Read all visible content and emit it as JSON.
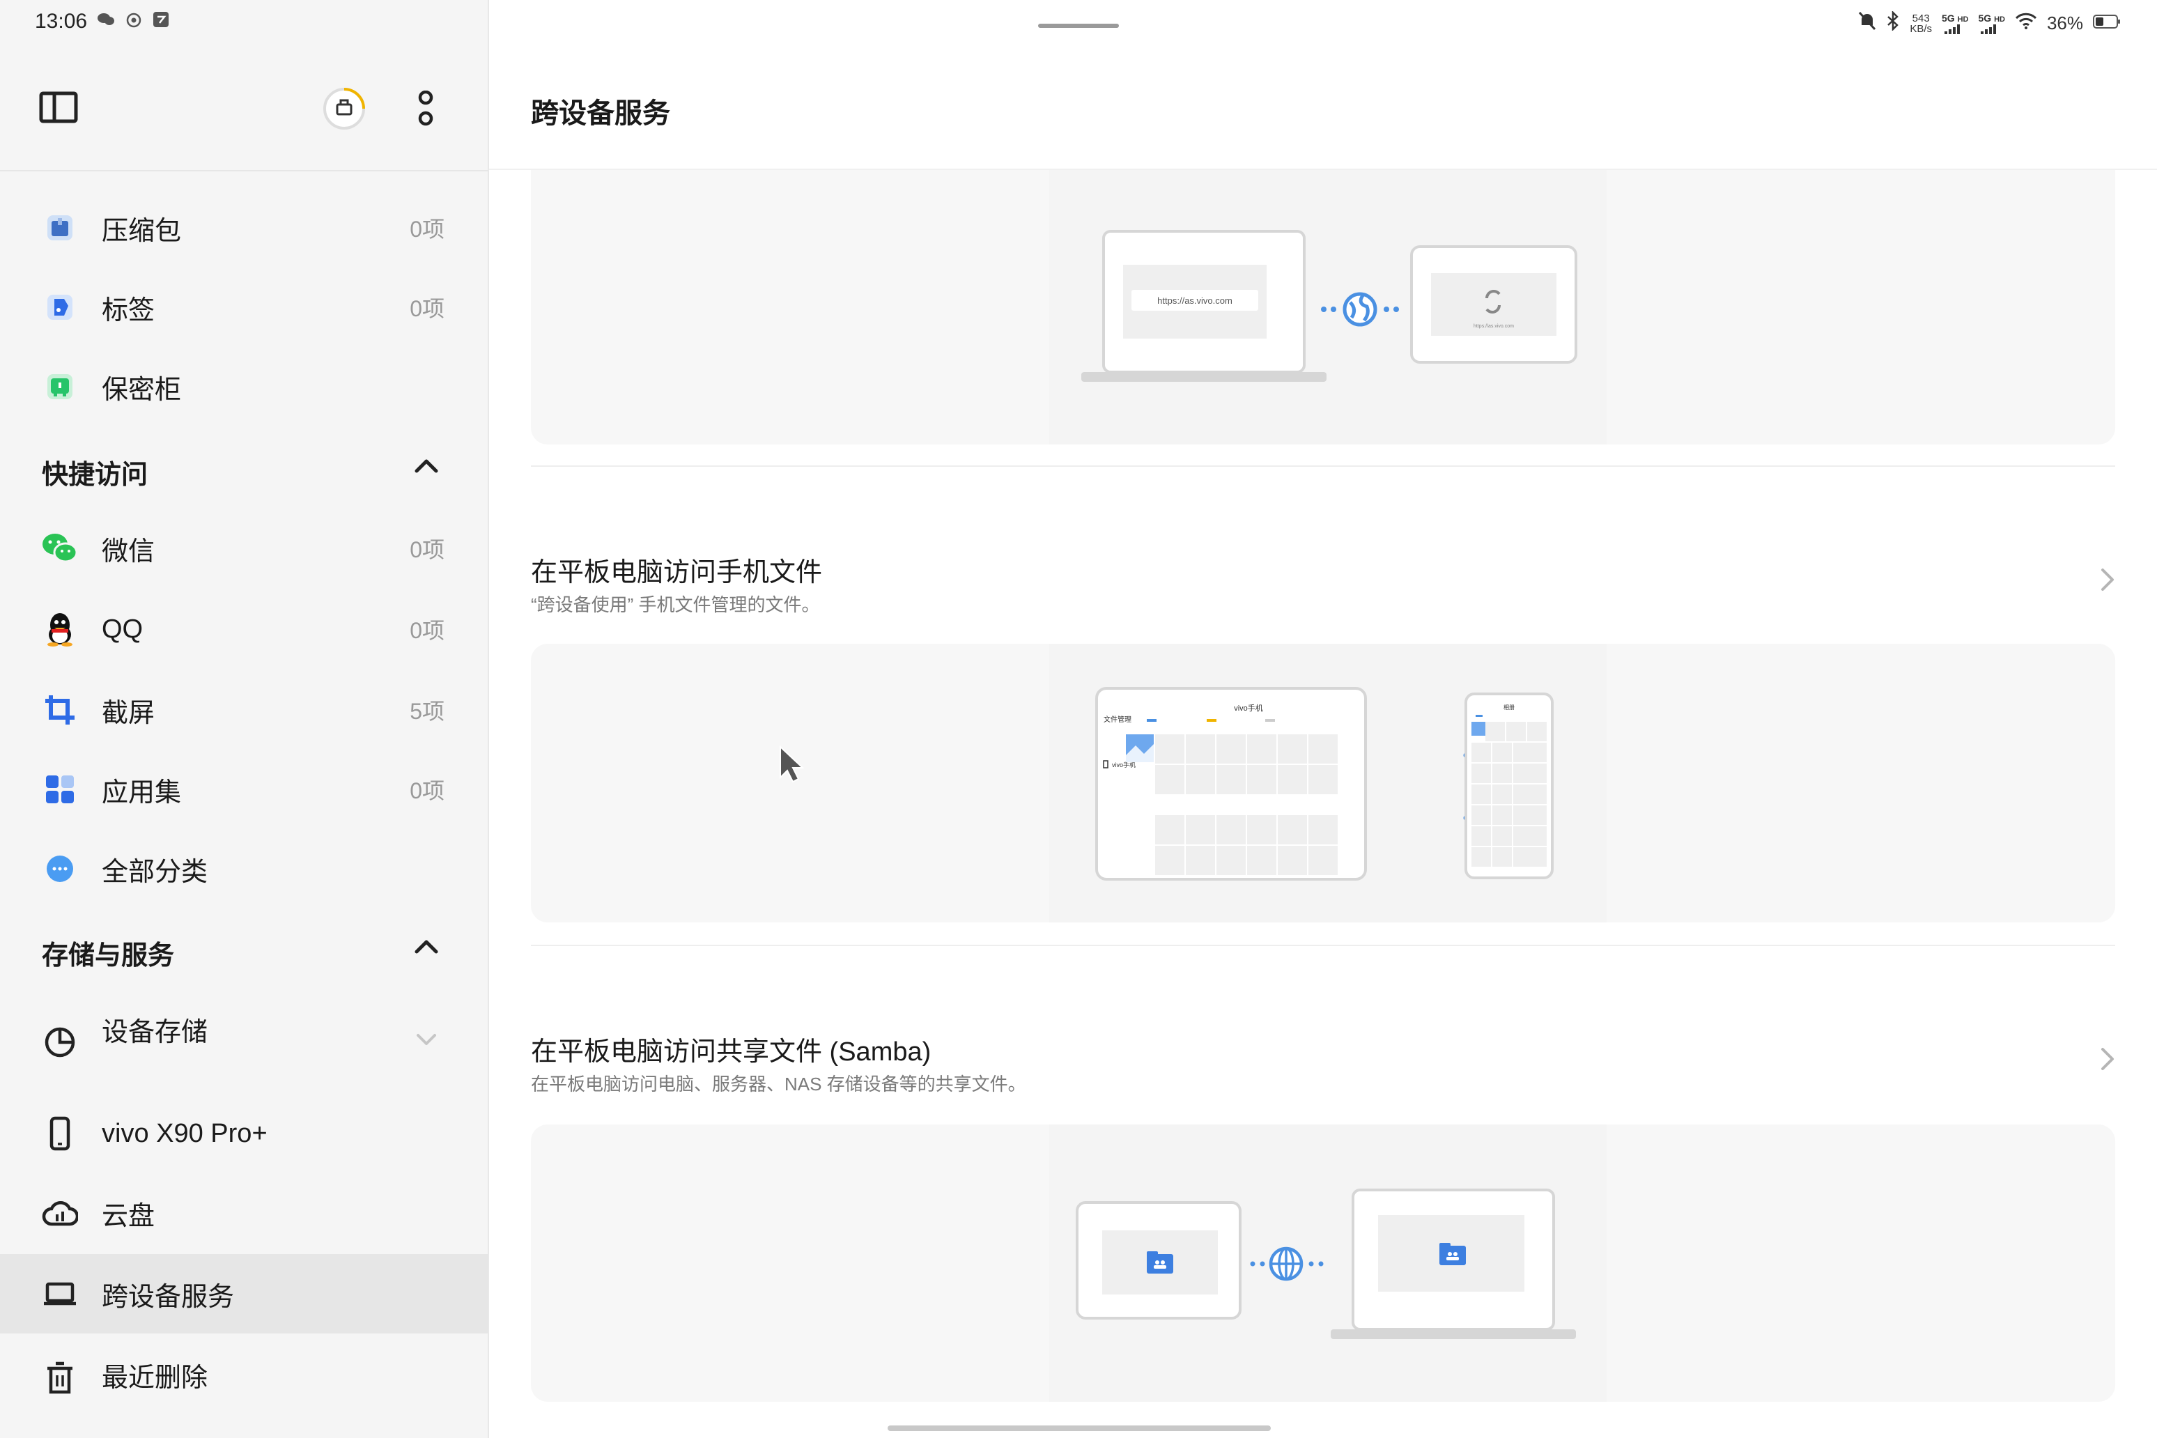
{
  "status_bar": {
    "time": "13:06",
    "net_speed_top": "543",
    "net_speed_unit": "KB/s",
    "sim1_label": "5G",
    "sim1_hd": "HD",
    "sim2_label": "5G",
    "sim2_hd": "HD",
    "battery_percent": "36%"
  },
  "sidebar": {
    "items_top": [
      {
        "label": "压缩包",
        "count": "0项",
        "icon": "archive-icon"
      },
      {
        "label": "标签",
        "count": "0项",
        "icon": "tag-icon"
      },
      {
        "label": "保密柜",
        "count": "",
        "icon": "safe-icon"
      }
    ],
    "quick_access": {
      "title": "快捷访问",
      "items": [
        {
          "label": "微信",
          "count": "0项",
          "icon": "wechat-icon"
        },
        {
          "label": "QQ",
          "count": "0项",
          "icon": "qq-icon"
        },
        {
          "label": "截屏",
          "count": "5项",
          "icon": "screenshot-icon"
        },
        {
          "label": "应用集",
          "count": "0项",
          "icon": "apps-icon"
        },
        {
          "label": "全部分类",
          "count": "",
          "icon": "more-categories-icon"
        }
      ]
    },
    "storage": {
      "title": "存储与服务",
      "items": [
        {
          "label": "设备存储",
          "icon": "pie-chart-icon"
        },
        {
          "label": "vivo X90 Pro+",
          "icon": "phone-icon"
        },
        {
          "label": "云盘",
          "icon": "cloud-icon"
        },
        {
          "label": "跨设备服务",
          "icon": "laptop-icon",
          "active": true
        },
        {
          "label": "最近删除",
          "icon": "trash-icon"
        }
      ]
    }
  },
  "main": {
    "title": "跨设备服务",
    "card1": {
      "url_text": "https://as.vivo.com",
      "url_small": "https://as.vivo.com"
    },
    "features": [
      {
        "title": "在平板电脑访问手机文件",
        "desc": "“跨设备使用” 手机文件管理的文件。",
        "illus": {
          "tablet_header": "vivo手机",
          "tablet_side_title": "文件管理",
          "tablet_side_device": "vivo手机",
          "phone_header": "相册"
        }
      },
      {
        "title": "在平板电脑访问共享文件 (Samba)",
        "desc": "在平板电脑访问电脑、服务器、NAS 存储设备等的共享文件。"
      }
    ]
  },
  "colors": {
    "accent": "#4a90e2",
    "sidebar_bg": "#f5f5f5",
    "active_bg": "#e6e6e6",
    "card_bg": "#f7f7f7"
  }
}
